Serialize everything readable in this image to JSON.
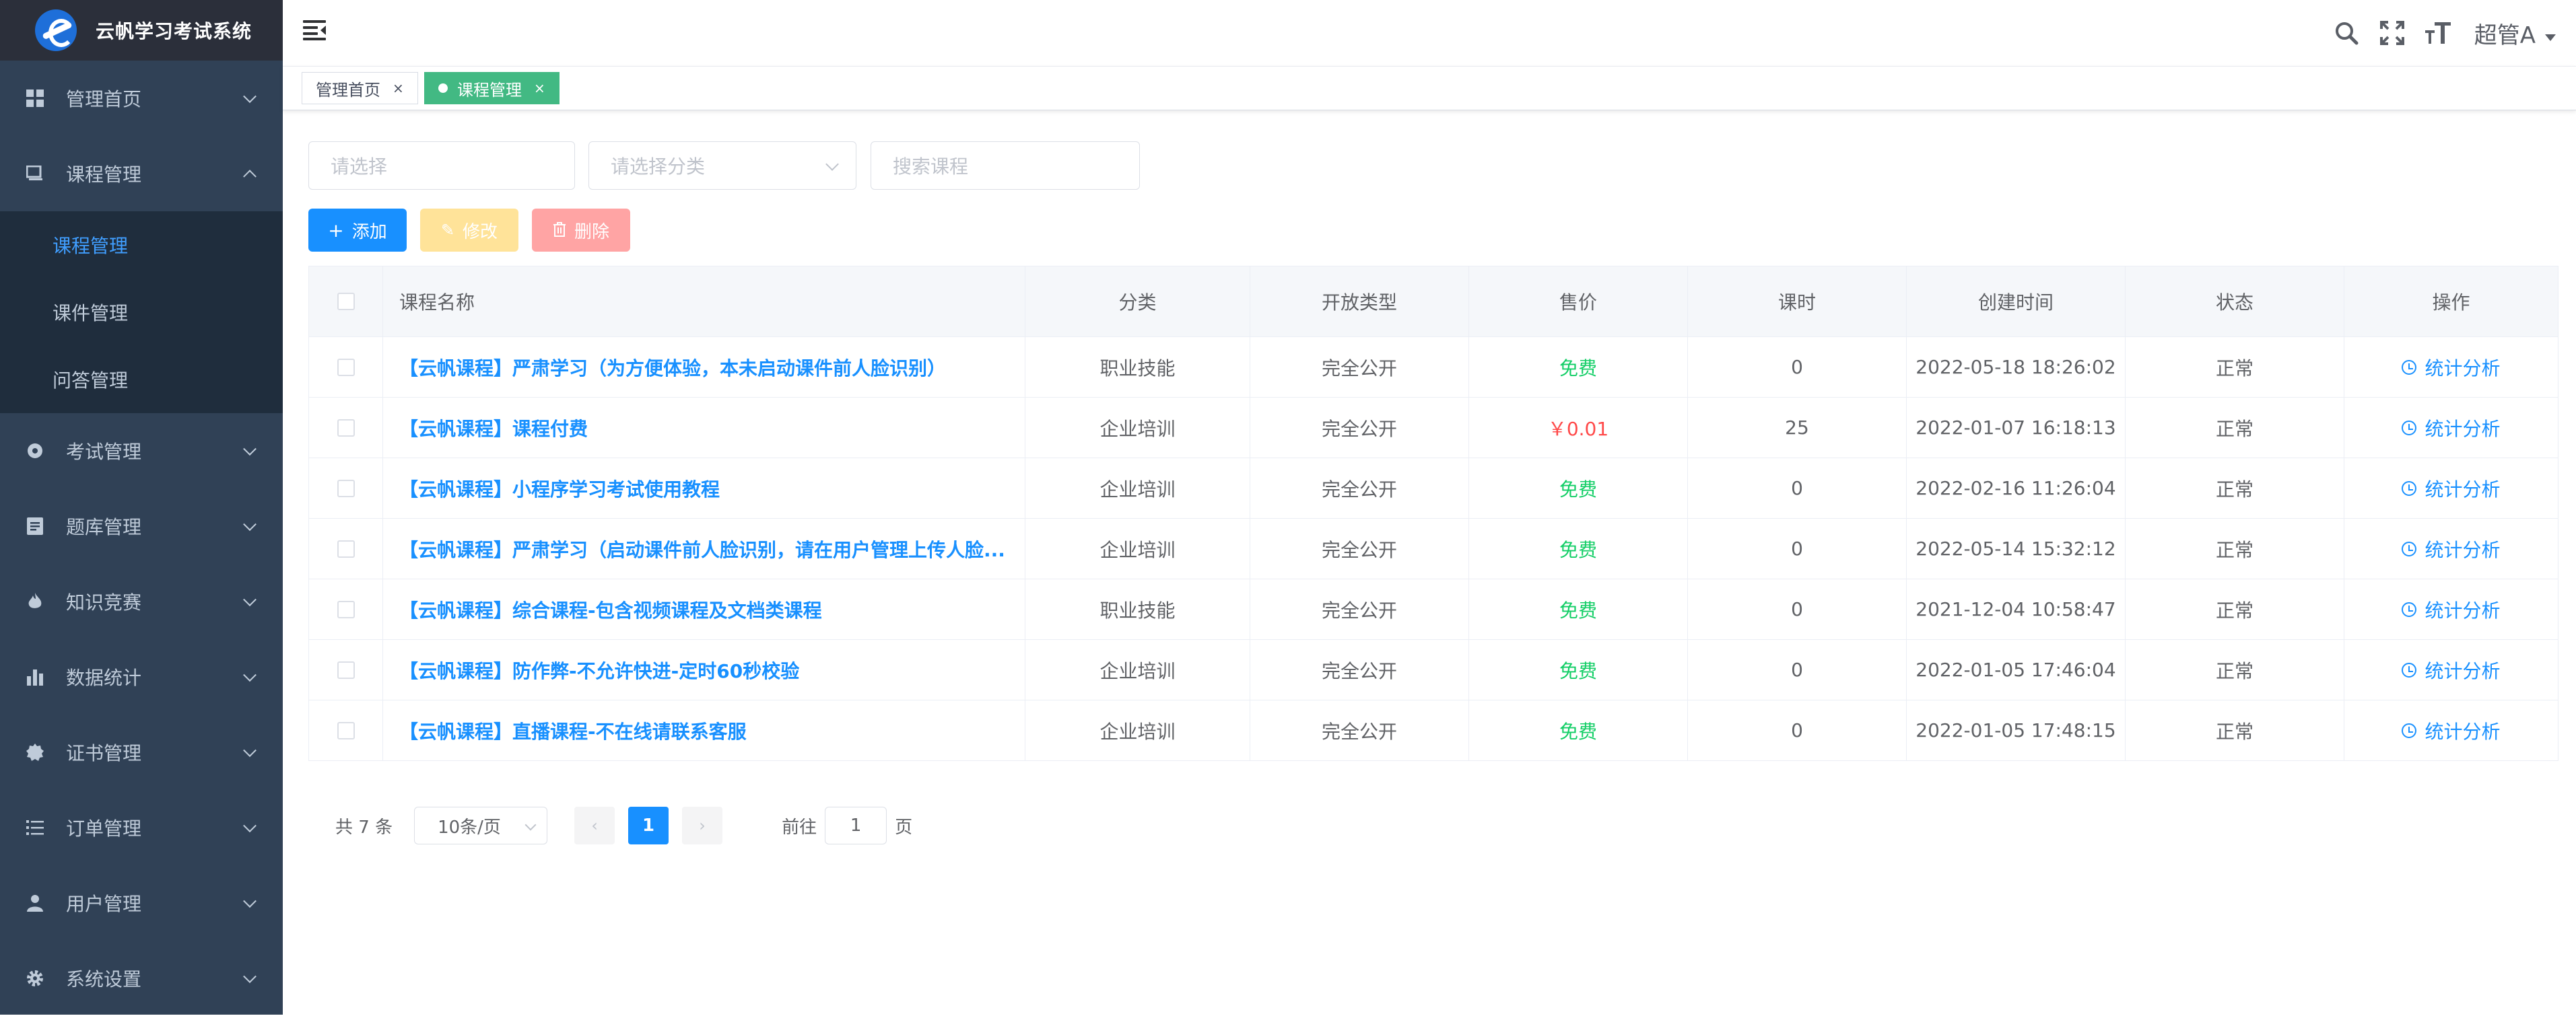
{
  "app": {
    "title": "云帆学习考试系统"
  },
  "sidebar": {
    "items": [
      {
        "label": "管理首页"
      },
      {
        "label": "课程管理",
        "open": true,
        "children": [
          {
            "label": "课程管理",
            "active": true
          },
          {
            "label": "课件管理"
          },
          {
            "label": "问答管理"
          }
        ]
      },
      {
        "label": "考试管理"
      },
      {
        "label": "题库管理"
      },
      {
        "label": "知识竞赛"
      },
      {
        "label": "数据统计"
      },
      {
        "label": "证书管理"
      },
      {
        "label": "订单管理"
      },
      {
        "label": "用户管理"
      },
      {
        "label": "系统设置"
      }
    ]
  },
  "header": {
    "user": "超管A",
    "icons": [
      "menu-fold-icon",
      "search-icon",
      "fullscreen-icon",
      "font-size-icon"
    ]
  },
  "tags": [
    {
      "label": "管理首页",
      "close": "×"
    },
    {
      "label": "课程管理",
      "close": "×",
      "active": true
    }
  ],
  "filters": {
    "select_placeholder": "请选择",
    "category_placeholder": "请选择分类",
    "search_placeholder": "搜索课程"
  },
  "toolbar": {
    "add": "添加",
    "edit": "修改",
    "delete": "删除"
  },
  "table": {
    "columns": [
      "课程名称",
      "分类",
      "开放类型",
      "售价",
      "课时",
      "创建时间",
      "状态",
      "操作"
    ],
    "rows": [
      {
        "name": "【云帆课程】严肃学习（为方便体验，本未启动课件前人脸识别）",
        "category": "职业技能",
        "open_type": "完全公开",
        "price": "免费",
        "hours": "0",
        "created": "2022-05-18 18:26:02",
        "status": "正常",
        "action": "统计分析"
      },
      {
        "name": "【云帆课程】课程付费",
        "category": "企业培训",
        "open_type": "完全公开",
        "price": "￥0.01",
        "hours": "25",
        "created": "2022-01-07 16:18:13",
        "status": "正常",
        "action": "统计分析"
      },
      {
        "name": "【云帆课程】小程序学习考试使用教程",
        "category": "企业培训",
        "open_type": "完全公开",
        "price": "免费",
        "hours": "0",
        "created": "2022-02-16 11:26:04",
        "status": "正常",
        "action": "统计分析"
      },
      {
        "name": "【云帆课程】严肃学习（启动课件前人脸识别，请在用户管理上传人脸...",
        "category": "企业培训",
        "open_type": "完全公开",
        "price": "免费",
        "hours": "0",
        "created": "2022-05-14 15:32:12",
        "status": "正常",
        "action": "统计分析"
      },
      {
        "name": "【云帆课程】综合课程-包含视频课程及文档类课程",
        "category": "职业技能",
        "open_type": "完全公开",
        "price": "免费",
        "hours": "0",
        "created": "2021-12-04 10:58:47",
        "status": "正常",
        "action": "统计分析"
      },
      {
        "name": "【云帆课程】防作弊-不允许快进-定时60秒校验",
        "category": "企业培训",
        "open_type": "完全公开",
        "price": "免费",
        "hours": "0",
        "created": "2022-01-05 17:46:04",
        "status": "正常",
        "action": "统计分析"
      },
      {
        "name": "【云帆课程】直播课程-不在线请联系客服",
        "category": "企业培训",
        "open_type": "完全公开",
        "price": "免费",
        "hours": "0",
        "created": "2022-01-05 17:48:15",
        "status": "正常",
        "action": "统计分析"
      }
    ]
  },
  "pagination": {
    "total": "共 7 条",
    "page_size": "10条/页",
    "prev": "‹",
    "current": "1",
    "next": "›",
    "goto_label": "前往",
    "goto_value": "1",
    "page_suffix": "页"
  },
  "colors": {
    "sidebar_bg": "#304156",
    "accent": "#1890ff",
    "tag_active": "#42b983",
    "free": "#13ce66",
    "paid": "#ff4949"
  }
}
